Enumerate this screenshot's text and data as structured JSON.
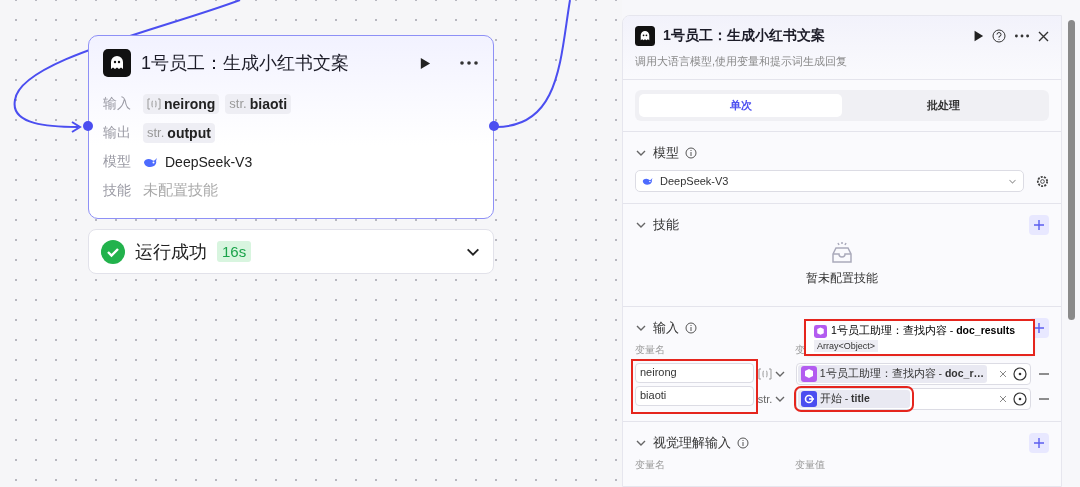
{
  "node": {
    "title": "1号员工：生成小红书文案",
    "fields": [
      {
        "kind": "tags",
        "label": "输入",
        "tags": [
          {
            "kind": "array",
            "name": "neirong"
          },
          {
            "kind": "string",
            "prefix": "str.",
            "name": "biaoti"
          }
        ]
      },
      {
        "kind": "tags",
        "label": "输出",
        "tags": [
          {
            "kind": "string",
            "prefix": "str.",
            "name": "output"
          }
        ]
      },
      {
        "kind": "model",
        "label": "模型",
        "value": "DeepSeek-V3"
      },
      {
        "kind": "text",
        "label": "技能",
        "value": "未配置技能"
      }
    ]
  },
  "status": {
    "success": true,
    "text": "运行成功",
    "duration": "16s"
  },
  "panel": {
    "title": "1号员工：生成小红书文案",
    "subtitle": "调用大语言模型,使用变量和提示词生成回复",
    "tabs": [
      {
        "label": "单次",
        "selected": true
      },
      {
        "label": "批处理",
        "selected": false
      }
    ],
    "model_section": {
      "title": "模型",
      "expanded": true,
      "model": "DeepSeek-V3"
    },
    "skills_section": {
      "title": "技能",
      "expanded": true,
      "empty_text": "暂未配置技能"
    },
    "inputs_section": {
      "title": "输入",
      "expanded": true,
      "columns": [
        "变量名",
        "变"
      ],
      "names_highlighted": true,
      "rows": [
        {
          "name": "neirong",
          "kind": "array",
          "source": {
            "kind": "node",
            "node": "1号员工助理：查找内容 -",
            "field": "doc_r…",
            "highlighted": false
          }
        },
        {
          "name": "biaoti",
          "kind": "string",
          "type_label": "str.",
          "source": {
            "kind": "start",
            "node": "开始 -",
            "field": "title",
            "highlighted": true
          }
        }
      ],
      "tooltip": {
        "node": "1号员工助理：查找内容 -",
        "field": "doc_results",
        "type_text": "Array<Object>",
        "highlighted": true
      }
    },
    "vision_section": {
      "title": "视觉理解输入",
      "expanded": true,
      "columns": [
        "变量名",
        "变量值"
      ]
    }
  }
}
